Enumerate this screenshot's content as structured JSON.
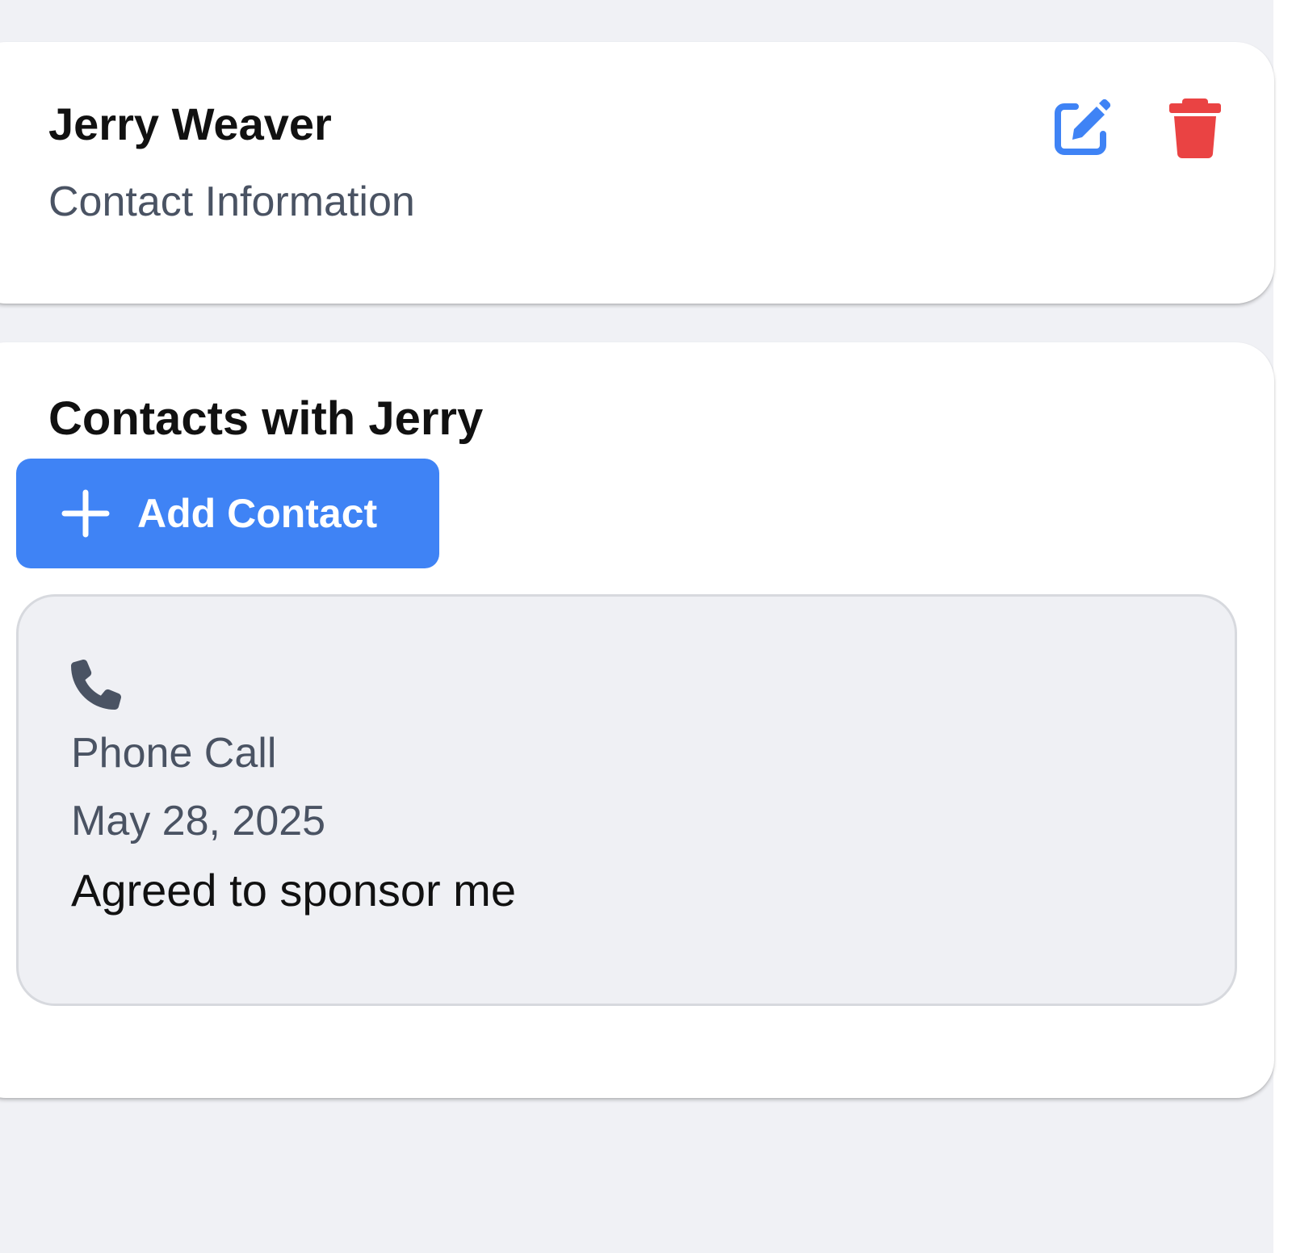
{
  "header": {
    "name": "Jerry Weaver",
    "subtitle": "Contact Information",
    "edit_icon": "edit-icon",
    "delete_icon": "trash-icon",
    "edit_color": "#3f83f5",
    "delete_color": "#ea4343"
  },
  "contacts_section": {
    "title": "Contacts with Jerry",
    "add_button_label": "Add Contact",
    "add_button_icon": "plus-icon",
    "accent_color": "#3f83f5",
    "items": [
      {
        "icon": "phone-icon",
        "type": "Phone Call",
        "date": "May 28, 2025",
        "note": "Agreed to sponsor me"
      }
    ]
  }
}
